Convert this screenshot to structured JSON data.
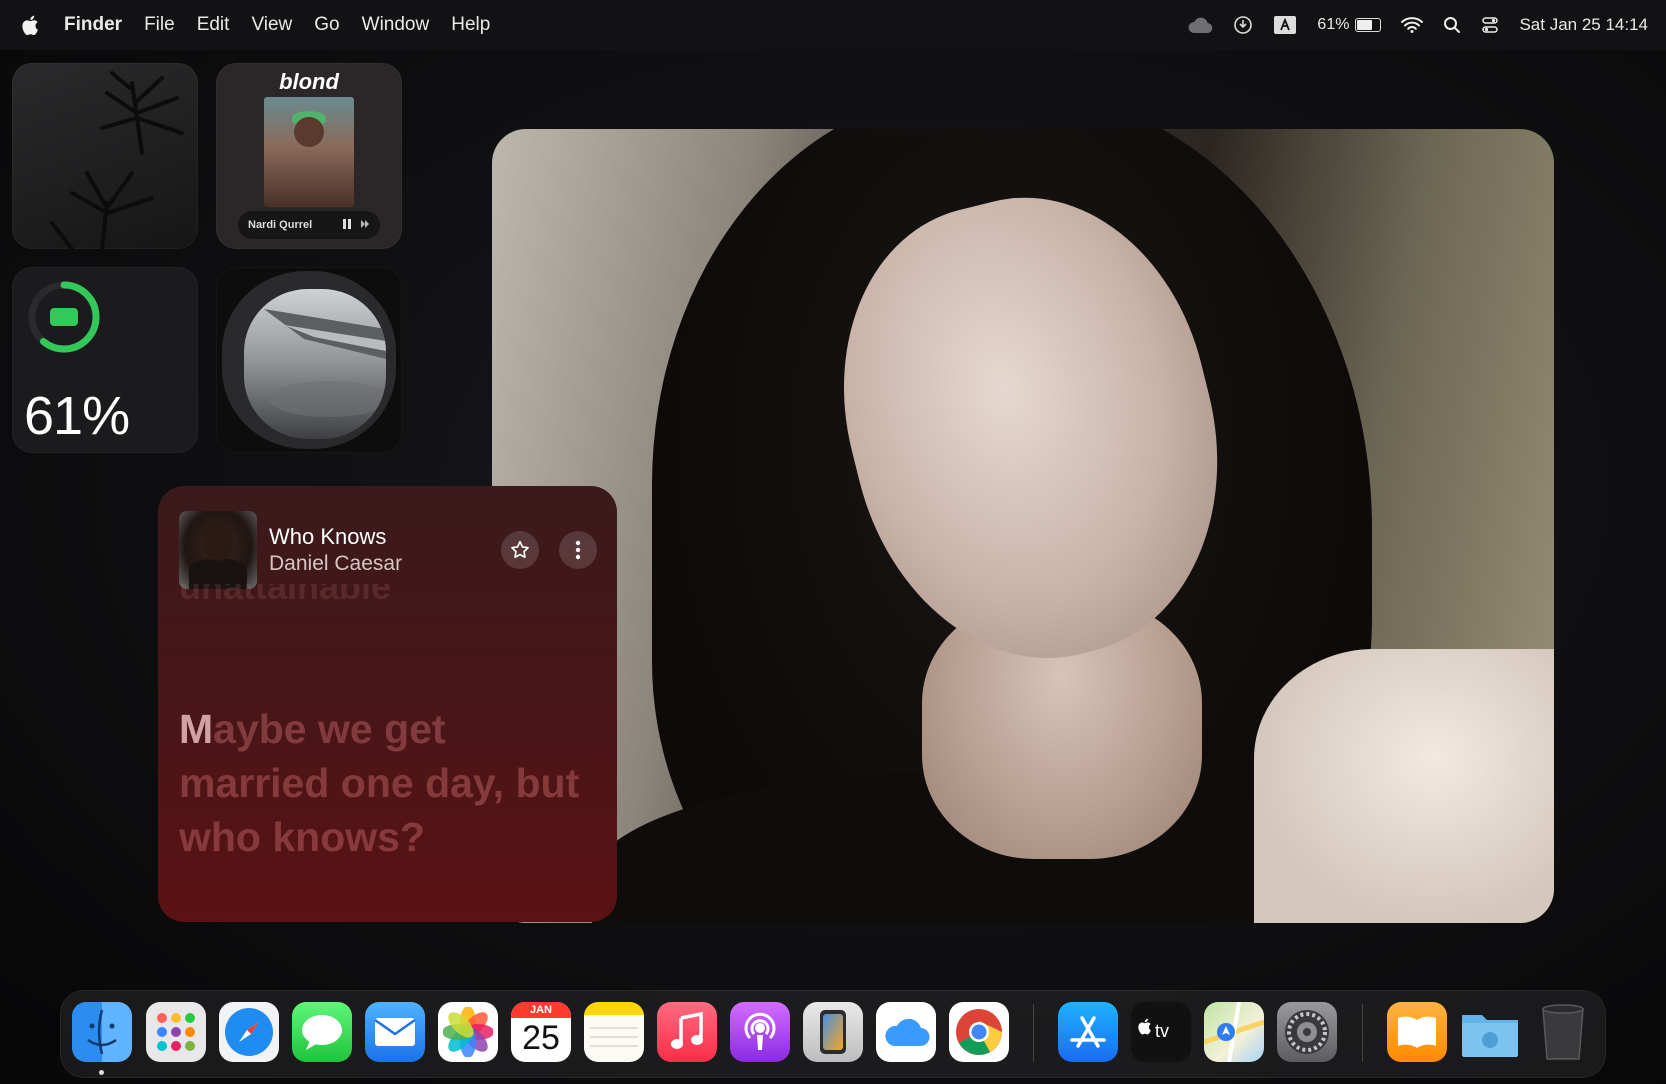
{
  "menubar": {
    "app_name": "Finder",
    "menus": [
      "File",
      "Edit",
      "View",
      "Go",
      "Window",
      "Help"
    ],
    "battery_percent": "61%",
    "datetime": "Sat Jan 25  14:14"
  },
  "widgets": {
    "music_small": {
      "album_title": "blond",
      "now_playing": "Nardi Qurrel"
    },
    "battery": {
      "percent_label": "61%",
      "level": 0.61,
      "ring_color": "#34c759"
    }
  },
  "music": {
    "song": "Who Knows",
    "artist": "Daniel Caesar",
    "previous_lyric": "unattainable",
    "lyric_first_letter": "M",
    "lyric_rest": "aybe we get married one day, but who knows?"
  },
  "dock": {
    "calendar": {
      "month": "JAN",
      "day": "25"
    },
    "apps": [
      "finder-icon",
      "launchpad-icon",
      "safari-icon",
      "messages-icon",
      "mail-icon",
      "photos-icon",
      "calendar-icon",
      "notes-icon",
      "music-icon",
      "podcasts-icon",
      "iphone-mirroring-icon",
      "icloud-icon",
      "chrome-icon",
      "app-store-icon",
      "apple-tv-icon",
      "maps-icon",
      "system-settings-icon",
      "books-icon",
      "downloads-folder-icon",
      "trash-icon"
    ]
  }
}
